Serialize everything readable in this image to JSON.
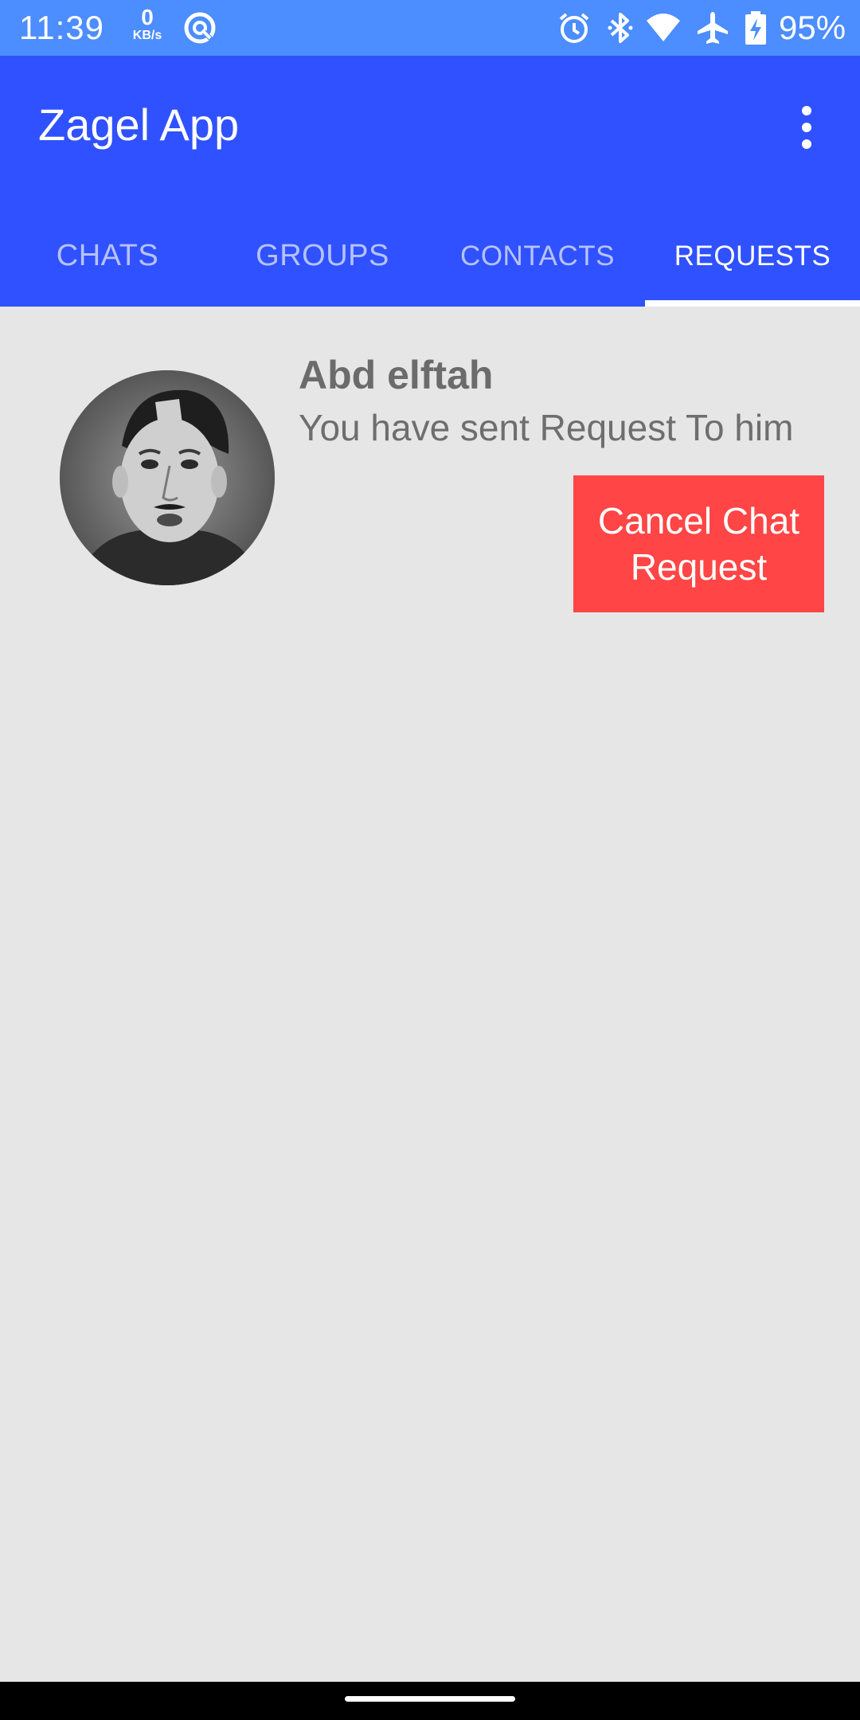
{
  "status_bar": {
    "time": "11:39",
    "net_speed_value": "0",
    "net_speed_unit": "KB/s",
    "battery_percent": "95%",
    "icons": [
      "data-saver-icon",
      "alarm-icon",
      "bluetooth-icon",
      "wifi-icon",
      "airplane-icon",
      "battery-charging-icon"
    ]
  },
  "app_bar": {
    "title": "Zagel App",
    "menu_icon": "more-vert-icon"
  },
  "tabs": [
    {
      "label": "CHATS",
      "active": false
    },
    {
      "label": "GROUPS",
      "active": false
    },
    {
      "label": "CONTACTS",
      "active": false
    },
    {
      "label": "REQUESTS",
      "active": true
    }
  ],
  "requests": [
    {
      "name": "Abd elftah",
      "status": "You have sent Request To him",
      "action_label": "Cancel Chat Request"
    }
  ],
  "colors": {
    "status_bar": "#4c8dff",
    "app_bar": "#2f51ff",
    "background": "#e6e6e6",
    "cancel_button": "#ff4545",
    "text_gray": "#6b6b6b"
  }
}
